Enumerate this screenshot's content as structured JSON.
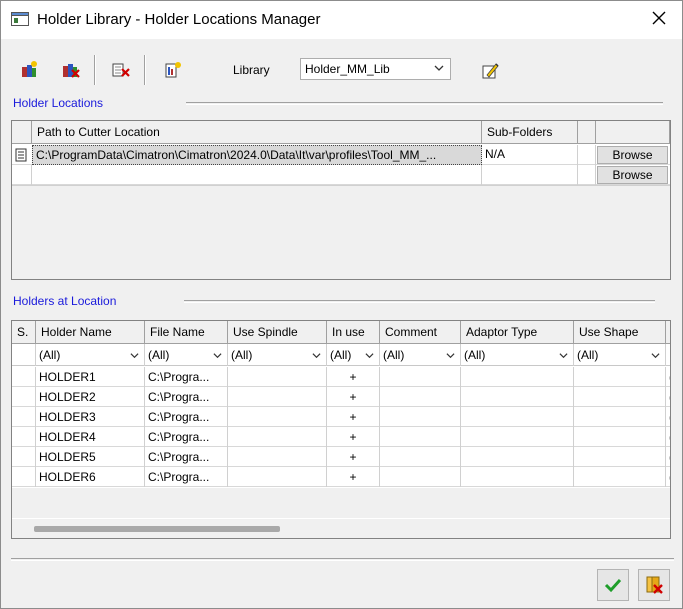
{
  "window": {
    "title": "Holder Library - Holder Locations Manager",
    "app_icon": "window-icon",
    "close_icon": "close-icon"
  },
  "toolbar": {
    "buttons": [
      {
        "name": "new-location-icon"
      },
      {
        "name": "delete-location-icon"
      },
      {
        "name": "remove-icon"
      },
      {
        "name": "add-holder-icon"
      }
    ],
    "library_label": "Library",
    "library_value": "Holder_MM_Lib",
    "edit_icon": "edit-icon"
  },
  "locations": {
    "section_title": "Holder Locations",
    "columns": [
      "Path to Cutter Location",
      "Sub-Folders"
    ],
    "rows": [
      {
        "path": "C:\\ProgramData\\Cimatron\\Cimatron\\2024.0\\Data\\It\\var\\profiles\\Tool_MM_...",
        "subfolders": "N/A",
        "browse": "Browse"
      },
      {
        "path": "",
        "subfolders": "",
        "browse": "Browse"
      }
    ]
  },
  "holders": {
    "section_title": "Holders at Location",
    "columns": [
      "S.",
      "Holder Name",
      "File Name",
      "Use Spindle",
      "In use",
      "Comment",
      "Adaptor Type",
      "Use Shape"
    ],
    "filters": [
      "",
      "(All)",
      "(All)",
      "(All)",
      "(All)",
      "(All)",
      "(All)",
      "(All)"
    ],
    "rows": [
      {
        "name": "HOLDER1",
        "file": "C:\\Progra...",
        "in_use": "+"
      },
      {
        "name": "HOLDER2",
        "file": "C:\\Progra...",
        "in_use": "+"
      },
      {
        "name": "HOLDER3",
        "file": "C:\\Progra...",
        "in_use": "+"
      },
      {
        "name": "HOLDER4",
        "file": "C:\\Progra...",
        "in_use": "+"
      },
      {
        "name": "HOLDER5",
        "file": "C:\\Progra...",
        "in_use": "+"
      },
      {
        "name": "HOLDER6",
        "file": "C:\\Progra...",
        "in_use": "+"
      }
    ],
    "clipped_cell_text": "("
  },
  "footer": {
    "ok_icon": "checkmark-icon",
    "cancel_icon": "cancel-icon"
  }
}
